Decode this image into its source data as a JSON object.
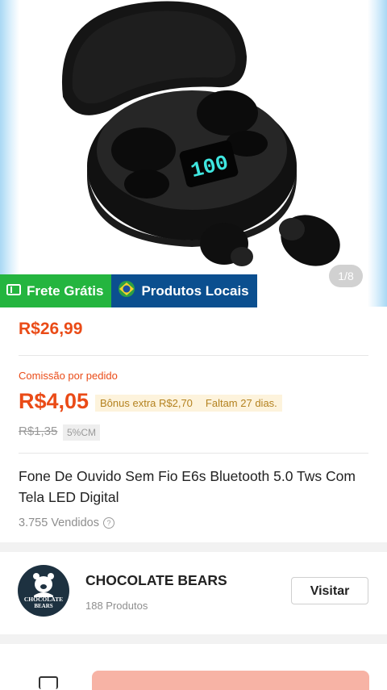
{
  "product": {
    "image_counter": "1/8",
    "screen_digits": "100",
    "badges": {
      "frete": "Frete Grátis",
      "local": "Produtos Locais"
    },
    "price": "R$26,99",
    "commission": {
      "label": "Comissão por pedido",
      "value": "R$4,05",
      "bonus": "Bônus extra R$2,70",
      "deadline": "Faltam 27 dias.",
      "old_value": "R$1,35",
      "rate": "5%CM"
    },
    "title": "Fone De Ouvido Sem Fio E6s Bluetooth 5.0 Tws Com Tela LED Digital",
    "sold": "3.755 Vendidos"
  },
  "store": {
    "name": "CHOCOLATE BEARS",
    "logo_text_line1": "CHOCOLATE",
    "logo_text_line2": "BEARS",
    "products": "188 Produtos",
    "visit_label": "Visitar"
  },
  "colors": {
    "accent": "#ea4b17",
    "frete_green": "#24b53f",
    "local_blue": "#0b4f8f",
    "bonus_bg": "#fdf3dc",
    "action": "#f7b3a5"
  }
}
